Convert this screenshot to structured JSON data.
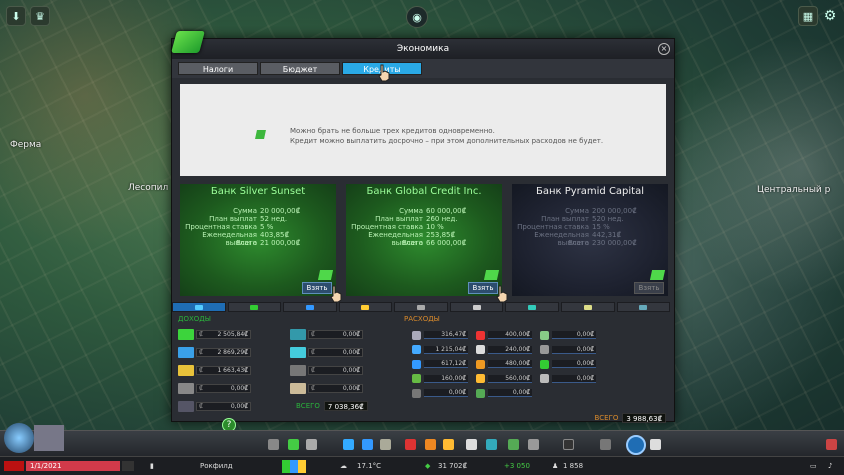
{
  "map": {
    "labels": [
      "Ферма",
      "Лесопил",
      "Центральный р"
    ]
  },
  "window": {
    "title": "Экономика",
    "close_icon": "×",
    "tabs": [
      {
        "label": "Налоги"
      },
      {
        "label": "Бюджет"
      },
      {
        "label": "Кредиты",
        "active": true
      }
    ],
    "info": {
      "line1": "Можно брать не больше трех кредитов одновременно.",
      "line2": "Кредит можно выплатить досрочно – при этом дополнительных расходов не будет."
    },
    "banks": [
      {
        "name": "Банк Silver Sunset",
        "rows": [
          {
            "label": "Сумма",
            "value": "20 000,00₡"
          },
          {
            "label": "План выплат",
            "value": "52 нед."
          },
          {
            "label": "Процентная ставка",
            "value": "5 %"
          },
          {
            "label": "Еженедельная выплата",
            "value": "403,85₡"
          },
          {
            "label": "Всего",
            "value": "21 000,00₡"
          }
        ],
        "button": "Взять",
        "available": true
      },
      {
        "name": "Банк Global Credit Inc.",
        "rows": [
          {
            "label": "Сумма",
            "value": "60 000,00₡"
          },
          {
            "label": "План выплат",
            "value": "260 нед."
          },
          {
            "label": "Процентная ставка",
            "value": "10 %"
          },
          {
            "label": "Еженедельная выплата",
            "value": "253,85₡"
          },
          {
            "label": "Всего",
            "value": "66 000,00₡"
          }
        ],
        "button": "Взять",
        "available": true
      },
      {
        "name": "Банк Pyramid Capital",
        "rows": [
          {
            "label": "Сумма",
            "value": "200 000,00₡"
          },
          {
            "label": "План выплат",
            "value": "520 нед."
          },
          {
            "label": "Процентная ставка",
            "value": "15 %"
          },
          {
            "label": "Еженедельная выплата",
            "value": "442,31₡"
          },
          {
            "label": "Всего",
            "value": "230 000,00₡"
          }
        ],
        "button": "Взять",
        "available": false
      }
    ],
    "income": {
      "title": "ДОХОДЫ",
      "left": [
        "2 505,84₡",
        "2 869,29₡",
        "1 663,43₡",
        "0,00₡",
        "0,00₡"
      ],
      "right": [
        "0,00₡",
        "0,00₡",
        "0,00₡",
        "0,00₡"
      ],
      "total_label": "ВСЕГО",
      "total": "7 038,36₡"
    },
    "expenses": {
      "title": "РАСХОДЫ",
      "col1": [
        "316,47₡",
        "1 215,04₡",
        "617,12₡",
        "160,00₡",
        "0,00₡"
      ],
      "col2": [
        "400,00₡",
        "240,00₡",
        "480,00₡",
        "560,00₡",
        "0,00₡"
      ],
      "col3": [
        "0,00₡",
        "0,00₡",
        "0,00₡",
        "0,00₡"
      ],
      "total_label": "ВСЕГО",
      "total": "3 988,63₡"
    }
  },
  "statusbar": {
    "city": "Рокфилд",
    "temperature": "17.1°C",
    "money": "31 702₡",
    "income_delta": "+3 050",
    "population": "1 858",
    "date": "1/1/2021"
  },
  "colors": {
    "accent": "#2aa9e6",
    "income": "#2ab33c",
    "expense": "#d98a2c",
    "bank_green": "#2e8c2e"
  }
}
